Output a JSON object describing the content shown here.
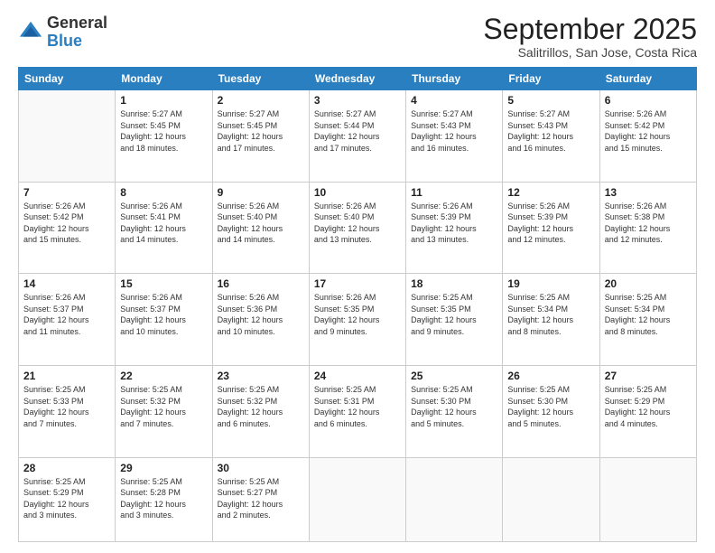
{
  "header": {
    "logo_general": "General",
    "logo_blue": "Blue",
    "month": "September 2025",
    "location": "Salitrillos, San Jose, Costa Rica"
  },
  "days_of_week": [
    "Sunday",
    "Monday",
    "Tuesday",
    "Wednesday",
    "Thursday",
    "Friday",
    "Saturday"
  ],
  "weeks": [
    [
      {
        "day": "",
        "info": ""
      },
      {
        "day": "1",
        "info": "Sunrise: 5:27 AM\nSunset: 5:45 PM\nDaylight: 12 hours\nand 18 minutes."
      },
      {
        "day": "2",
        "info": "Sunrise: 5:27 AM\nSunset: 5:45 PM\nDaylight: 12 hours\nand 17 minutes."
      },
      {
        "day": "3",
        "info": "Sunrise: 5:27 AM\nSunset: 5:44 PM\nDaylight: 12 hours\nand 17 minutes."
      },
      {
        "day": "4",
        "info": "Sunrise: 5:27 AM\nSunset: 5:43 PM\nDaylight: 12 hours\nand 16 minutes."
      },
      {
        "day": "5",
        "info": "Sunrise: 5:27 AM\nSunset: 5:43 PM\nDaylight: 12 hours\nand 16 minutes."
      },
      {
        "day": "6",
        "info": "Sunrise: 5:26 AM\nSunset: 5:42 PM\nDaylight: 12 hours\nand 15 minutes."
      }
    ],
    [
      {
        "day": "7",
        "info": "Sunrise: 5:26 AM\nSunset: 5:42 PM\nDaylight: 12 hours\nand 15 minutes."
      },
      {
        "day": "8",
        "info": "Sunrise: 5:26 AM\nSunset: 5:41 PM\nDaylight: 12 hours\nand 14 minutes."
      },
      {
        "day": "9",
        "info": "Sunrise: 5:26 AM\nSunset: 5:40 PM\nDaylight: 12 hours\nand 14 minutes."
      },
      {
        "day": "10",
        "info": "Sunrise: 5:26 AM\nSunset: 5:40 PM\nDaylight: 12 hours\nand 13 minutes."
      },
      {
        "day": "11",
        "info": "Sunrise: 5:26 AM\nSunset: 5:39 PM\nDaylight: 12 hours\nand 13 minutes."
      },
      {
        "day": "12",
        "info": "Sunrise: 5:26 AM\nSunset: 5:39 PM\nDaylight: 12 hours\nand 12 minutes."
      },
      {
        "day": "13",
        "info": "Sunrise: 5:26 AM\nSunset: 5:38 PM\nDaylight: 12 hours\nand 12 minutes."
      }
    ],
    [
      {
        "day": "14",
        "info": "Sunrise: 5:26 AM\nSunset: 5:37 PM\nDaylight: 12 hours\nand 11 minutes."
      },
      {
        "day": "15",
        "info": "Sunrise: 5:26 AM\nSunset: 5:37 PM\nDaylight: 12 hours\nand 10 minutes."
      },
      {
        "day": "16",
        "info": "Sunrise: 5:26 AM\nSunset: 5:36 PM\nDaylight: 12 hours\nand 10 minutes."
      },
      {
        "day": "17",
        "info": "Sunrise: 5:26 AM\nSunset: 5:35 PM\nDaylight: 12 hours\nand 9 minutes."
      },
      {
        "day": "18",
        "info": "Sunrise: 5:25 AM\nSunset: 5:35 PM\nDaylight: 12 hours\nand 9 minutes."
      },
      {
        "day": "19",
        "info": "Sunrise: 5:25 AM\nSunset: 5:34 PM\nDaylight: 12 hours\nand 8 minutes."
      },
      {
        "day": "20",
        "info": "Sunrise: 5:25 AM\nSunset: 5:34 PM\nDaylight: 12 hours\nand 8 minutes."
      }
    ],
    [
      {
        "day": "21",
        "info": "Sunrise: 5:25 AM\nSunset: 5:33 PM\nDaylight: 12 hours\nand 7 minutes."
      },
      {
        "day": "22",
        "info": "Sunrise: 5:25 AM\nSunset: 5:32 PM\nDaylight: 12 hours\nand 7 minutes."
      },
      {
        "day": "23",
        "info": "Sunrise: 5:25 AM\nSunset: 5:32 PM\nDaylight: 12 hours\nand 6 minutes."
      },
      {
        "day": "24",
        "info": "Sunrise: 5:25 AM\nSunset: 5:31 PM\nDaylight: 12 hours\nand 6 minutes."
      },
      {
        "day": "25",
        "info": "Sunrise: 5:25 AM\nSunset: 5:30 PM\nDaylight: 12 hours\nand 5 minutes."
      },
      {
        "day": "26",
        "info": "Sunrise: 5:25 AM\nSunset: 5:30 PM\nDaylight: 12 hours\nand 5 minutes."
      },
      {
        "day": "27",
        "info": "Sunrise: 5:25 AM\nSunset: 5:29 PM\nDaylight: 12 hours\nand 4 minutes."
      }
    ],
    [
      {
        "day": "28",
        "info": "Sunrise: 5:25 AM\nSunset: 5:29 PM\nDaylight: 12 hours\nand 3 minutes."
      },
      {
        "day": "29",
        "info": "Sunrise: 5:25 AM\nSunset: 5:28 PM\nDaylight: 12 hours\nand 3 minutes."
      },
      {
        "day": "30",
        "info": "Sunrise: 5:25 AM\nSunset: 5:27 PM\nDaylight: 12 hours\nand 2 minutes."
      },
      {
        "day": "",
        "info": ""
      },
      {
        "day": "",
        "info": ""
      },
      {
        "day": "",
        "info": ""
      },
      {
        "day": "",
        "info": ""
      }
    ]
  ]
}
